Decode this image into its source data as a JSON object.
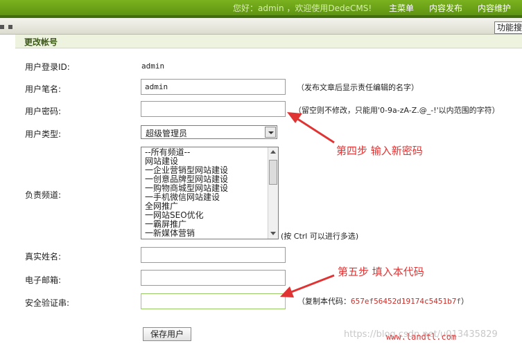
{
  "header": {
    "greeting": "您好：admin ，欢迎使用DedeCMS!",
    "nav": [
      "主菜单",
      "内容发布",
      "内容维护"
    ],
    "func_button": "功能搜"
  },
  "panel": {
    "title": "更改帐号"
  },
  "form": {
    "login_id": {
      "label": "用户登录ID:",
      "value": "admin"
    },
    "pen_name": {
      "label": "用户笔名:",
      "value": "admin",
      "hint": "（发布文章后显示责任编辑的名字）"
    },
    "password": {
      "label": "用户密码:",
      "value": "",
      "hint": "（留空则不修改，只能用'0-9a-zA-Z.@_-!'以内范围的字符）"
    },
    "user_type": {
      "label": "用户类型:",
      "selected": "超级管理员"
    },
    "channels": {
      "label": "负责频道:",
      "options": [
        "--所有频道--",
        "网站建设",
        "一企业营销型网站建设",
        "一创意品牌型网站建设",
        "一购物商城型网站建设",
        "一手机微信网站建设",
        "全网推广",
        "一网站SEO优化",
        "一霸屏推广",
        "一新媒体营销"
      ],
      "hint": "(按 Ctrl 可以进行多选)"
    },
    "real_name": {
      "label": "真实姓名:",
      "value": ""
    },
    "email": {
      "label": "电子邮箱:",
      "value": ""
    },
    "verify_code": {
      "label": "安全验证串:",
      "value": "",
      "hint_prefix": "（复制本代码：",
      "code": "657ef56452d19174c5451b7f",
      "hint_suffix": "）"
    },
    "save_label": "保存用户"
  },
  "annotations": {
    "step4": "第四步  输入新密码",
    "step5": "第五步  填入本代码",
    "color": "#e03434"
  },
  "footer": {
    "watermark": "https://blog.csdn.net/u013435829",
    "site": "www.landtl.com"
  }
}
